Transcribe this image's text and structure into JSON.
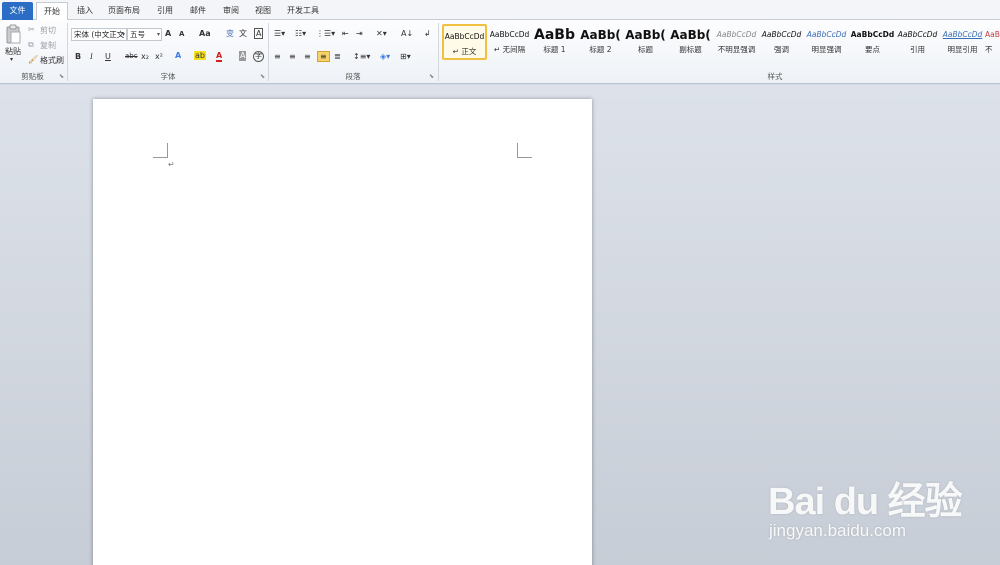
{
  "tabs": [
    {
      "label": "文件"
    },
    {
      "label": "开始"
    },
    {
      "label": "插入"
    },
    {
      "label": "页面布局"
    },
    {
      "label": "引用"
    },
    {
      "label": "邮件"
    },
    {
      "label": "审阅"
    },
    {
      "label": "视图"
    },
    {
      "label": "开发工具"
    }
  ],
  "clipboard": {
    "paste": "粘贴",
    "cut": "剪切",
    "copy": "复制",
    "format_painter": "格式刷",
    "group_label": "剪贴板"
  },
  "font": {
    "font_name": "宋体 (中文正文",
    "font_size": "五号",
    "group_label": "字体",
    "grow": "A",
    "shrink": "A",
    "change_case": "Aa",
    "bold": "B",
    "italic": "I",
    "underline": "U",
    "strike": "abc",
    "subscript": "x₂",
    "superscript": "x²",
    "highlight": "ab",
    "font_color": "A",
    "char_shading": "A",
    "char_border": "A",
    "enclose": "字",
    "phonetic": "文",
    "clear_format": "变"
  },
  "paragraph": {
    "group_label": "段落"
  },
  "styles": {
    "group_label": "样式",
    "items": [
      {
        "sample": "AaBbCcDd",
        "name": "↵ 正文"
      },
      {
        "sample": "AaBbCcDd",
        "name": "↵ 无间隔"
      },
      {
        "sample": "AaBb",
        "name": "标题 1"
      },
      {
        "sample": "AaBb(",
        "name": "标题 2"
      },
      {
        "sample": "AaBb(",
        "name": "标题"
      },
      {
        "sample": "AaBb(",
        "name": "副标题"
      },
      {
        "sample": "AaBbCcDd",
        "name": "不明显强调"
      },
      {
        "sample": "AaBbCcDd",
        "name": "强调"
      },
      {
        "sample": "AaBbCcDd",
        "name": "明显强调"
      },
      {
        "sample": "AaBbCcDd",
        "name": "要点"
      },
      {
        "sample": "AaBbCcDd",
        "name": "引用"
      },
      {
        "sample": "AaBbCcDd",
        "name": "明显引用"
      },
      {
        "sample": "AaBb",
        "name": "不"
      }
    ]
  },
  "document": {
    "paragraph_mark": "↵"
  },
  "watermark": {
    "logo": "Bai du 经验",
    "url": "jingyan.baidu.com"
  },
  "colors": {
    "file_tab": "#2b6cc4",
    "selected_style_border": "#f0c040",
    "highlight_yellow": "#f5e020",
    "font_red": "#d02020"
  }
}
